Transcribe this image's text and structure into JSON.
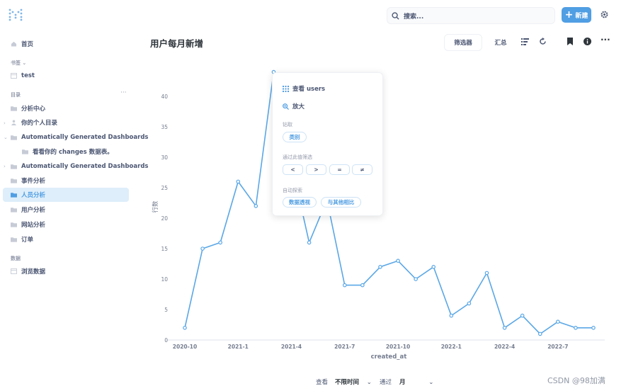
{
  "topbar": {
    "search_placeholder": "搜索...",
    "new_label": "新建"
  },
  "sidebar": {
    "home": "首页",
    "bookmarks_header": "书签",
    "bookmark_items": [
      "test"
    ],
    "collections_header": "目录",
    "collections": [
      {
        "label": "分析中心"
      },
      {
        "label": "你的个人目录"
      },
      {
        "label": "Automatically Generated Dashboards"
      },
      {
        "label": "看看你的 changes 数据表。"
      },
      {
        "label": "Automatically Generated Dashboards"
      },
      {
        "label": "事件分析"
      },
      {
        "label": "人员分析"
      },
      {
        "label": "用户分析"
      },
      {
        "label": "网站分析"
      },
      {
        "label": "订单"
      }
    ],
    "data_header": "数据",
    "browse_data": "浏览数据"
  },
  "main": {
    "title": "用户每月新增",
    "filter_label": "筛选器",
    "summarize_label": "汇总"
  },
  "popover": {
    "view_users": "查看 users",
    "zoom": "放大",
    "drill_header": "钻取",
    "drill_category": "类别",
    "filter_header": "通过此值筛选",
    "filter_ops": [
      "<",
      ">",
      "=",
      "≠"
    ],
    "explore_header": "自动探索",
    "pivot": "数据透视",
    "compare": "与其他相比"
  },
  "footer": {
    "view_label": "查看",
    "time_value": "不限时间",
    "by_label": "通过",
    "unit_value": "月"
  },
  "watermark": "CSDN @98加满",
  "colors": {
    "accent": "#509ee3",
    "line": "#5aa7e6",
    "active_bg": "#deeefa"
  },
  "chart_data": {
    "type": "line",
    "xlabel": "created_at",
    "ylabel": "行数",
    "ylim": [
      0,
      45
    ],
    "yticks": [
      0,
      5,
      10,
      15,
      20,
      25,
      30,
      35,
      40
    ],
    "x": [
      "2020-10",
      "2020-11",
      "2020-12",
      "2021-1",
      "2021-2",
      "2021-3",
      "2021-4",
      "2021-5",
      "2021-6",
      "2021-7",
      "2021-8",
      "2021-9",
      "2021-10",
      "2021-11",
      "2021-12",
      "2022-1",
      "2022-2",
      "2022-3",
      "2022-4",
      "2022-5",
      "2022-6",
      "2022-7",
      "2022-8",
      "2022-9"
    ],
    "xtick_labels": [
      "2020-10",
      "2021-1",
      "2021-4",
      "2021-7",
      "2021-10",
      "2022-1",
      "2022-4",
      "2022-7"
    ],
    "values": [
      2,
      15,
      16,
      26,
      22,
      44,
      29,
      16,
      23,
      9,
      9,
      12,
      13,
      10,
      12,
      4,
      6,
      11,
      2,
      4,
      1,
      3,
      2,
      2
    ]
  }
}
